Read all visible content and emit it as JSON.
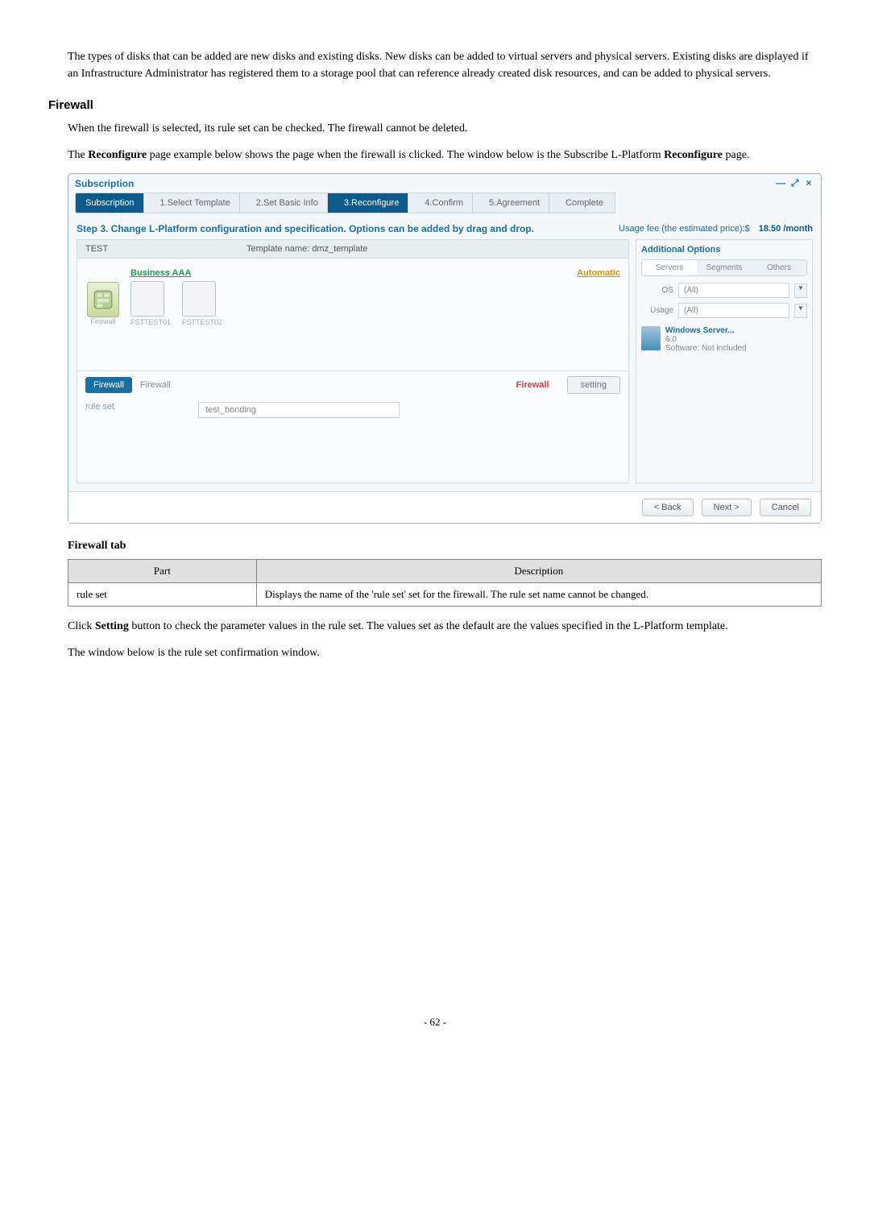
{
  "intro_paragraph": "The types of disks that can be added are new disks and existing disks. New disks can be added to virtual servers and physical servers. Existing disks are displayed if an Infrastructure Administrator has registered them to a storage pool that can reference already created disk resources, and can be added to physical servers.",
  "section_title": "Firewall",
  "fw_para1": "When the firewall is selected, its rule set can be checked. The firewall cannot be deleted.",
  "fw_para2_a": "The ",
  "fw_para2_b": "Reconfigure",
  "fw_para2_c": " page example below shows the page when the firewall is clicked. The window below is the Subscribe L-Platform ",
  "fw_para2_d": "Reconfigure",
  "fw_para2_e": " page.",
  "app": {
    "title": "Subscription",
    "window_controls": {
      "min": "—",
      "max": "⤢",
      "close": "×"
    },
    "crumbs": {
      "c0": "Subscription",
      "c1": "1.Select Template",
      "c2": "2.Set Basic Info",
      "c3": "3.Reconfigure",
      "c4": "4.Confirm",
      "c5": "5.Agreement",
      "c6": "Complete"
    },
    "step_text": "Step 3. Change L-Platform configuration and specification. Options can be added by drag and drop.",
    "usage_label": "Usage fee (the estimated price):$",
    "usage_value": "18.50 /month",
    "canvas": {
      "left": "TEST",
      "mid": "Template name: dmz_template",
      "business": "Business AAA",
      "automatic": "Automatic",
      "fw_caption": "Firewall",
      "srv1": "FSTTEST01",
      "srv2": "FSTTEST02"
    },
    "detail": {
      "tab": "Firewall",
      "title": "Firewall",
      "fw_label": "Firewall",
      "setting": "setting",
      "key": "rule set",
      "val": "test_bonding"
    },
    "sidebar": {
      "header": "Additional Options",
      "tab1": "Servers",
      "tab2": "Segments",
      "tab3": "Others",
      "os_label": "OS",
      "os_val": "(All)",
      "usage_label": "Usage",
      "usage_val": "(All)",
      "server_name": "Windows Server...",
      "ver": "6.0",
      "sw_label": "Software:",
      "sw_val": "Not included"
    },
    "buttons": {
      "back": "< Back",
      "next": "Next >",
      "cancel": "Cancel"
    }
  },
  "table": {
    "caption": "Firewall tab",
    "h1": "Part",
    "h2": "Description",
    "r1c1": "rule set",
    "r1c2": "Displays the name of the 'rule set' set for the firewall. The rule set name cannot be changed."
  },
  "p_after1_a": "Click ",
  "p_after1_b": "Setting",
  "p_after1_c": " button to check the parameter values in the rule set. The values set as the default are the values specified in the L-Platform template.",
  "p_after2": "The window below is the rule set confirmation window.",
  "page_num": "- 62 -"
}
